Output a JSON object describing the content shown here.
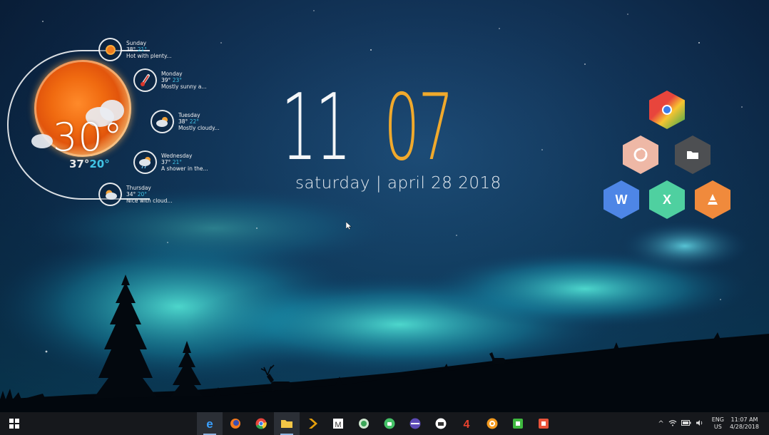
{
  "clock": {
    "hour": "11",
    "minute": "07",
    "date": "saturday | april 28 2018"
  },
  "weather": {
    "current_temp": "30°",
    "current_high": "37°",
    "current_low": "20°",
    "forecast": [
      {
        "day": "Sunday",
        "high": "38°",
        "low": "21°",
        "summary": "Hot with plenty...",
        "icon": "sun-icon"
      },
      {
        "day": "Monday",
        "high": "39°",
        "low": "23°",
        "summary": "Mostly sunny a...",
        "icon": "thermometer-icon"
      },
      {
        "day": "Tuesday",
        "high": "38°",
        "low": "22°",
        "summary": "Mostly cloudy...",
        "icon": "cloudy-icon"
      },
      {
        "day": "Wednesday",
        "high": "37°",
        "low": "21°",
        "summary": "A shower in the...",
        "icon": "shower-icon"
      },
      {
        "day": "Thursday",
        "high": "34°",
        "low": "20°",
        "summary": "Nice with cloud...",
        "icon": "partly-cloudy-icon"
      }
    ]
  },
  "launcher": {
    "word_label": "W",
    "excel_label": "X"
  },
  "taskbar": {
    "apps": [
      "edge",
      "firefox",
      "chrome",
      "file-explorer",
      "plex",
      "mediamonkey",
      "android",
      "android-studio",
      "vpn",
      "printer",
      "app-4",
      "photo-app",
      "camtasia",
      "screen-recorder"
    ],
    "tray": {
      "lang_top": "ENG",
      "lang_bottom": "US",
      "time": "11:07 AM",
      "date": "4/28/2018"
    }
  },
  "colors": {
    "accent": "#f0a92c",
    "cold": "#41c4e6"
  }
}
